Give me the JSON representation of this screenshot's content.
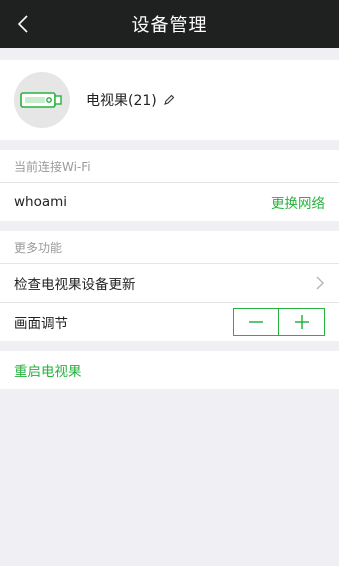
{
  "header": {
    "title": "设备管理"
  },
  "device": {
    "name": "电视果(21)"
  },
  "wifi": {
    "section_label": "当前连接Wi-Fi",
    "ssid": "whoami",
    "change_label": "更换网络"
  },
  "more": {
    "section_label": "更多功能",
    "check_update_label": "检查电视果设备更新",
    "picture_adjust_label": "画面调节"
  },
  "reboot_label": "重启电视果",
  "colors": {
    "accent": "#27b23d",
    "header_bg": "#1f2120",
    "page_bg": "#efeff4"
  }
}
